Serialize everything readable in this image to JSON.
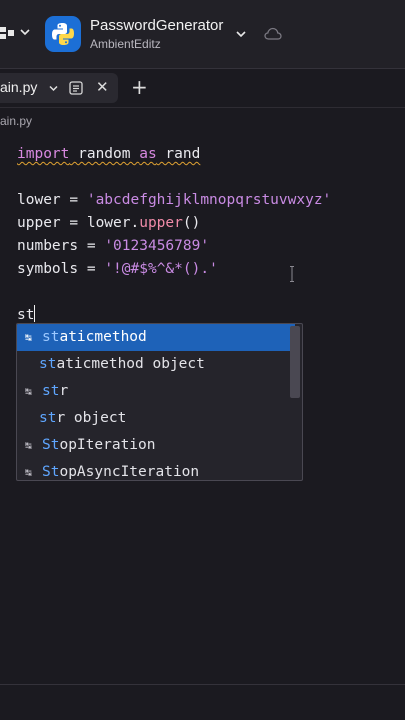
{
  "header": {
    "project_name": "PasswordGenerator",
    "project_owner": "AmbientEditz",
    "logo_icon": "python-logo-icon",
    "cloud_icon": "cloud-icon"
  },
  "tabs": [
    {
      "label": "ain.py",
      "active": true
    }
  ],
  "breadcrumb": "ain.py",
  "code": {
    "line1": {
      "kw1": "import",
      "mid": " random ",
      "kw2": "as",
      "end": " rand"
    },
    "line3": {
      "pre": "lower = ",
      "str": "'abcdefghijklmnopqrstuvwxyz'"
    },
    "line4": {
      "pre": "upper = lower.",
      "fn": "upper",
      "post": "()"
    },
    "line5": {
      "pre": "numbers = ",
      "str": "'0123456789'"
    },
    "line6": {
      "pre": "symbols = ",
      "str": "'!@#$%^&*().'"
    },
    "line8": {
      "typed": "st"
    }
  },
  "autocomplete": {
    "items": [
      {
        "match": "st",
        "rest": "aticmethod",
        "icon": true,
        "selected": true
      },
      {
        "match": "st",
        "rest": "aticmethod object",
        "icon": false,
        "selected": false
      },
      {
        "match": "st",
        "rest": "r",
        "icon": true,
        "selected": false
      },
      {
        "match": "st",
        "rest": "r object",
        "icon": false,
        "selected": false
      },
      {
        "match": "St",
        "rest": "opIteration",
        "icon": true,
        "selected": false
      },
      {
        "match": "St",
        "rest": "opAsyncIteration",
        "icon": true,
        "selected": false
      }
    ]
  },
  "colors": {
    "background": "#1b1a20",
    "selection": "#1e62b8",
    "keyword": "#d889e0",
    "string": "#c98be3"
  }
}
